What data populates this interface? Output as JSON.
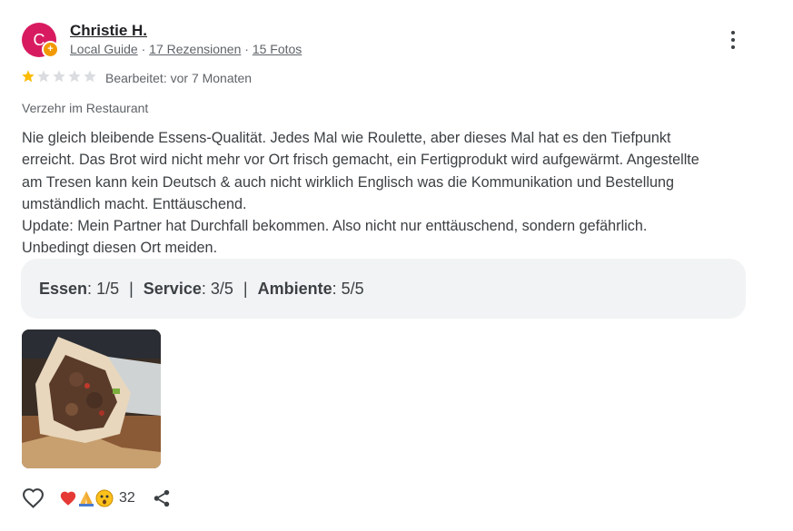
{
  "author": {
    "initial": "C",
    "name": "Christie H.",
    "badge": "Local Guide",
    "reviews": "17 Rezensionen",
    "photos": "15 Fotos"
  },
  "rating": {
    "stars": 1,
    "max": 5
  },
  "edited": "Bearbeitet: vor 7 Monaten",
  "visit_type": "Verzehr im Restaurant",
  "review_lines": [
    "Nie gleich bleibende Essens-Qualität. Jedes Mal wie Roulette, aber dieses Mal hat es den Tiefpunkt",
    "erreicht. Das Brot wird nicht mehr vor Ort frisch gemacht, ein Fertigprodukt wird aufgewärmt. Angestellte",
    "am Tresen kann kein Deutsch & auch nicht wirklich Englisch was die Kommunikation und Bestellung",
    "umständlich macht. Enttäuschend.",
    "Update: Mein Partner hat Durchfall bekommen. Also nicht nur enttäuschend, sondern gefährlich.",
    "Unbedingt diesen Ort meiden."
  ],
  "sub_ratings": {
    "food_label": "Essen",
    "food_value": "1/5",
    "service_label": "Service",
    "service_value": "3/5",
    "ambience_label": "Ambiente",
    "ambience_value": "5/5"
  },
  "reactions": {
    "count": "32"
  },
  "colors": {
    "avatar": "#d81b60",
    "star_on": "#fbbc04",
    "star_off": "#dadce0"
  }
}
